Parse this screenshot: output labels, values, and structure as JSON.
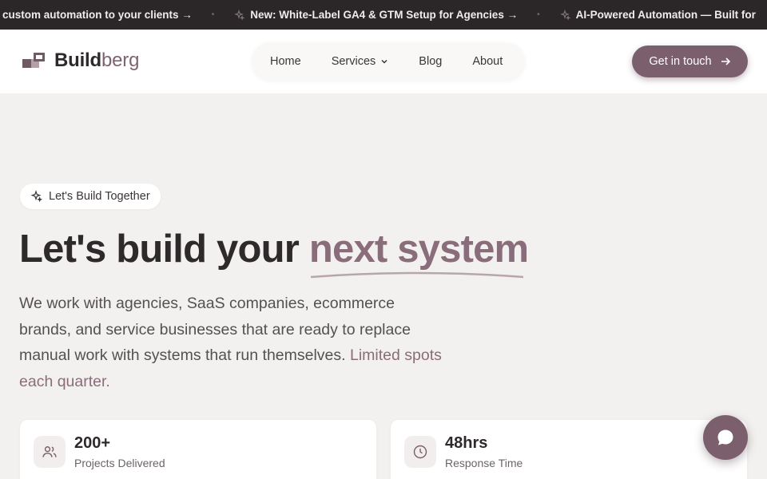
{
  "ticker": {
    "items": [
      "r custom automation to your clients →",
      "New: White-Label GA4 & GTM Setup for Agencies →",
      "AI-Powered Automation — Built for"
    ],
    "separator": "•"
  },
  "brand": {
    "part1": "Build",
    "part2": "berg"
  },
  "nav": {
    "home": "Home",
    "services": "Services",
    "blog": "Blog",
    "about": "About"
  },
  "cta": {
    "label": "Get in touch"
  },
  "hero": {
    "badge": "Let's Build Together",
    "headline_main": "Let's build your ",
    "headline_accent": "next system",
    "lead_main": "We work with agencies, SaaS companies, ecommerce brands, and service businesses that are ready to replace manual work with systems that run themselves. ",
    "lead_accent": "Limited spots each quarter."
  },
  "stats": [
    {
      "value": "200+",
      "label": "Projects Delivered",
      "icon": "users-icon"
    },
    {
      "value": "48hrs",
      "label": "Response Time",
      "icon": "clock-icon"
    }
  ],
  "colors": {
    "accent": "#7b5f6c",
    "ticker_bg": "#2b2627",
    "page_bg": "#f3f1ef"
  },
  "icons": {
    "ticker": "sparkle-icon",
    "badge": "sparkle-icon",
    "chat": "chat-bubble-icon",
    "cta": "arrow-right-icon"
  }
}
